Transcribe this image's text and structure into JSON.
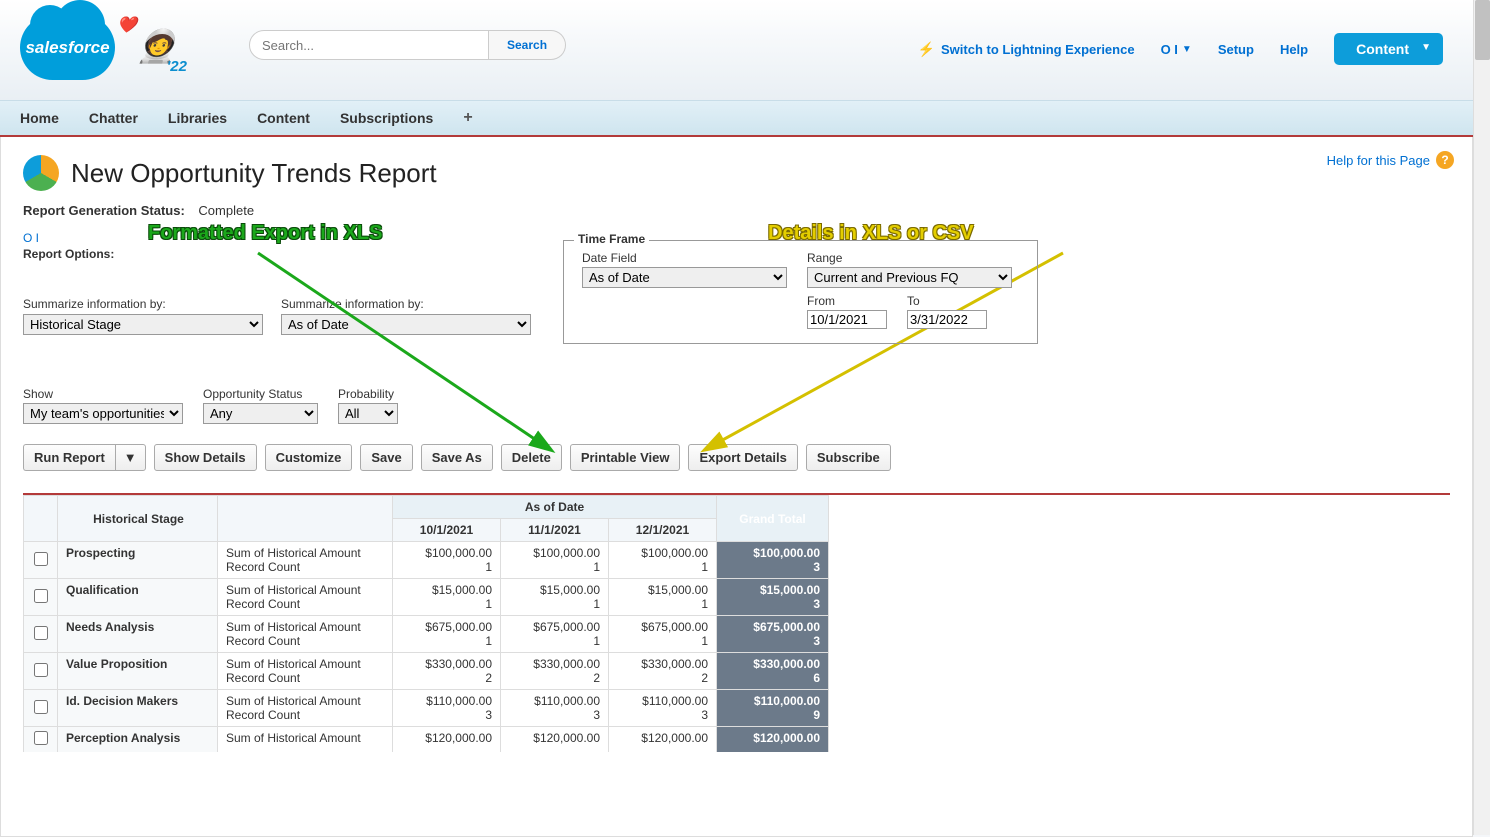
{
  "header": {
    "brand": "salesforce",
    "year": "'22",
    "search_placeholder": "Search...",
    "search_button": "Search",
    "lightning_link": "Switch to Lightning Experience",
    "user_label": "O I",
    "setup": "Setup",
    "help": "Help",
    "content_button": "Content"
  },
  "nav": {
    "items": [
      "Home",
      "Chatter",
      "Libraries",
      "Content",
      "Subscriptions"
    ],
    "plus": "+"
  },
  "page": {
    "help_link": "Help for this Page",
    "title": "New Opportunity Trends Report",
    "status_label": "Report Generation Status:",
    "status_value": "Complete",
    "user_link": "O I",
    "options_label": "Report Options:",
    "summarize1_label": "Summarize information by:",
    "summarize1_value": "Historical Stage",
    "summarize2_label": "Summarize information by:",
    "summarize2_value": "As of Date",
    "timeframe": {
      "legend": "Time Frame",
      "date_field_label": "Date Field",
      "date_field_value": "As of Date",
      "range_label": "Range",
      "range_value": "Current and Previous FQ",
      "from_label": "From",
      "from_value": "10/1/2021",
      "to_label": "To",
      "to_value": "3/31/2022"
    },
    "filters": {
      "show_label": "Show",
      "show_value": "My team's opportunities",
      "opp_status_label": "Opportunity Status",
      "opp_status_value": "Any",
      "probability_label": "Probability",
      "probability_value": "All"
    },
    "buttons": {
      "run": "Run Report",
      "caret": "▼",
      "show_details": "Show Details",
      "customize": "Customize",
      "save": "Save",
      "save_as": "Save As",
      "delete": "Delete",
      "printable": "Printable View",
      "export": "Export Details",
      "subscribe": "Subscribe"
    },
    "annotations": {
      "green": "Formatted Export in XLS",
      "yellow": "Details in XLS or CSV"
    }
  },
  "table": {
    "as_of_date_header": "As of Date",
    "stage_header": "Historical Stage",
    "grand_total_header": "Grand Total",
    "dates": [
      "10/1/2021",
      "11/1/2021",
      "12/1/2021"
    ],
    "metric1": "Sum of Historical Amount",
    "metric2": "Record Count",
    "rows": [
      {
        "stage": "Prospecting",
        "vals": [
          "$100,000.00",
          "$100,000.00",
          "$100,000.00"
        ],
        "counts": [
          "1",
          "1",
          "1"
        ],
        "grand_val": "$100,000.00",
        "grand_count": "3"
      },
      {
        "stage": "Qualification",
        "vals": [
          "$15,000.00",
          "$15,000.00",
          "$15,000.00"
        ],
        "counts": [
          "1",
          "1",
          "1"
        ],
        "grand_val": "$15,000.00",
        "grand_count": "3"
      },
      {
        "stage": "Needs Analysis",
        "vals": [
          "$675,000.00",
          "$675,000.00",
          "$675,000.00"
        ],
        "counts": [
          "1",
          "1",
          "1"
        ],
        "grand_val": "$675,000.00",
        "grand_count": "3"
      },
      {
        "stage": "Value Proposition",
        "vals": [
          "$330,000.00",
          "$330,000.00",
          "$330,000.00"
        ],
        "counts": [
          "2",
          "2",
          "2"
        ],
        "grand_val": "$330,000.00",
        "grand_count": "6"
      },
      {
        "stage": "Id. Decision Makers",
        "vals": [
          "$110,000.00",
          "$110,000.00",
          "$110,000.00"
        ],
        "counts": [
          "3",
          "3",
          "3"
        ],
        "grand_val": "$110,000.00",
        "grand_count": "9"
      }
    ],
    "cutoff": {
      "stage": "Perception Analysis",
      "metric": "Sum of Historical Amount",
      "vals": [
        "$120,000.00",
        "$120,000.00",
        "$120,000.00"
      ],
      "grand": "$120,000.00"
    }
  }
}
